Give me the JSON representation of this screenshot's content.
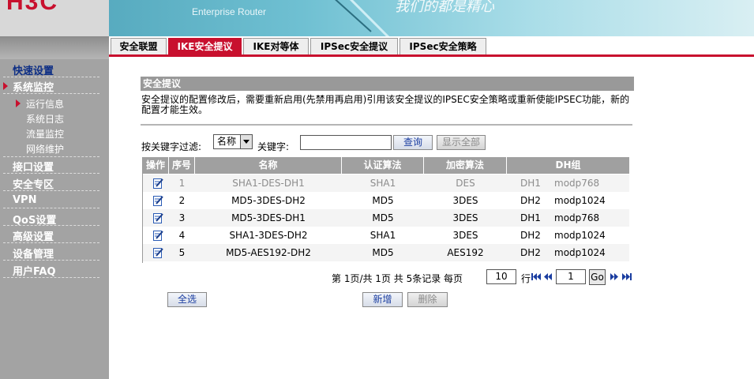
{
  "brand": {
    "logo": "H3C",
    "product": "Enterprise Router",
    "slogan": "我们的都是精心"
  },
  "sidebar": {
    "items": [
      {
        "label": "快速设置"
      },
      {
        "label": "系统监控"
      },
      {
        "label": "接口设置"
      },
      {
        "label": "安全专区"
      },
      {
        "label": "VPN"
      },
      {
        "label": "QoS设置"
      },
      {
        "label": "高级设置"
      },
      {
        "label": "设备管理"
      },
      {
        "label": "用户FAQ"
      }
    ],
    "subitems": [
      {
        "label": "运行信息"
      },
      {
        "label": "系统日志"
      },
      {
        "label": "流量监控"
      },
      {
        "label": "网络维护"
      }
    ]
  },
  "tabs": [
    {
      "label": "安全联盟"
    },
    {
      "label": "IKE安全提议"
    },
    {
      "label": "IKE对等体"
    },
    {
      "label": "IPSec安全提议"
    },
    {
      "label": "IPSec安全策略"
    }
  ],
  "section": {
    "title": "安全提议",
    "notice": "安全提议的配置修改后，需要重新启用(先禁用再启用)引用该安全提议的IPSEC安全策略或重新使能IPSEC功能，新的配置才能生效。"
  },
  "filter": {
    "label": "按关键字过滤:",
    "select_value": "名称",
    "keyword_label": "关键字:",
    "keyword_value": "",
    "search_label": "查询",
    "show_all_label": "显示全部"
  },
  "table": {
    "columns": [
      "操作",
      "序号",
      "名称",
      "认证算法",
      "加密算法",
      "DH组"
    ],
    "rows": [
      {
        "index": "1",
        "name": "SHA1-DES-DH1",
        "auth": "SHA1",
        "enc": "DES",
        "dh_id": "DH1",
        "dh_name": "modp768"
      },
      {
        "index": "2",
        "name": "MD5-3DES-DH2",
        "auth": "MD5",
        "enc": "3DES",
        "dh_id": "DH2",
        "dh_name": "modp1024"
      },
      {
        "index": "3",
        "name": "MD5-3DES-DH1",
        "auth": "MD5",
        "enc": "3DES",
        "dh_id": "DH1",
        "dh_name": "modp768"
      },
      {
        "index": "4",
        "name": "SHA1-3DES-DH2",
        "auth": "SHA1",
        "enc": "3DES",
        "dh_id": "DH2",
        "dh_name": "modp1024"
      },
      {
        "index": "5",
        "name": "MD5-AES192-DH2",
        "auth": "MD5",
        "enc": "AES192",
        "dh_id": "DH2",
        "dh_name": "modp1024"
      }
    ]
  },
  "pagination": {
    "summary": "第 1页/共 1页 共 5条记录 每页",
    "page_size": "10",
    "row_label": "行",
    "page_input": "1",
    "go_label": "Go"
  },
  "actions": {
    "select_all_label": "全选",
    "add_label": "新增",
    "delete_label": "删除"
  },
  "colors": {
    "accent": "#c8102e",
    "sidebar": "#a3a3a3",
    "table_header": "#a0a0a0"
  }
}
